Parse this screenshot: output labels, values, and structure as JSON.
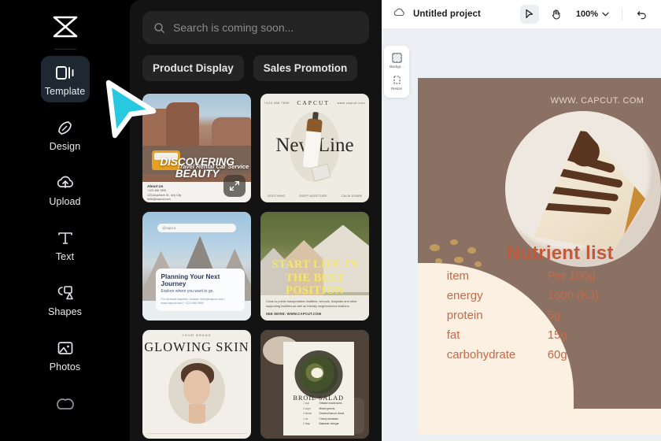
{
  "sidebar": {
    "logo_icon": "capcut-logo-icon",
    "items": [
      {
        "label": "Template",
        "icon": "template-icon",
        "active": true
      },
      {
        "label": "Design",
        "icon": "design-icon",
        "active": false
      },
      {
        "label": "Upload",
        "icon": "upload-cloud-icon",
        "active": false
      },
      {
        "label": "Text",
        "icon": "text-icon",
        "active": false
      },
      {
        "label": "Shapes",
        "icon": "shapes-icon",
        "active": false
      },
      {
        "label": "Photos",
        "icon": "photos-icon",
        "active": false
      }
    ]
  },
  "panel": {
    "search": {
      "placeholder": "Search is coming soon...",
      "icon": "search-icon"
    },
    "chips": [
      {
        "label": "Product Display"
      },
      {
        "label": "Sales Promotion"
      }
    ],
    "templates": [
      {
        "name": "travel-rental-car",
        "subtitle": "Travel Rental Car Service",
        "title": "DISCOVERING BEAUTY",
        "footer_heading": "About Us",
        "footer_lines": [
          "+123 456 7890",
          "123 Anywhere St., Any City",
          "hello@capcut.com"
        ],
        "expand_icon": "expand-icon"
      },
      {
        "name": "new-line-cosmetics",
        "brand": "CAPCUT",
        "top_left": "+123 456 7890",
        "top_right": "www.capcut.com",
        "title": "New Line",
        "footer": [
          "SOOTHING",
          "DEEP MOISTURE",
          "CALM DOWN"
        ]
      },
      {
        "name": "planning-next-journey",
        "url_bar": "@capcut",
        "title": "Planning Your Next Journey",
        "subtitle": "Explore where you want to go.",
        "footer": "For all travel inquiries, contact: hello@capcut.com | www.capcut.com | +123 456 7890"
      },
      {
        "name": "start-life-best-position",
        "title": "START LIFE IN THE BEST POSITION",
        "body": "Close to public transportation facilities, schools, hospitals and other supporting facilities,as well as friendly neighborhood relations.",
        "more": "SEE MORE: WWW.CAPCUT.COM"
      },
      {
        "name": "glowing-skin",
        "brand": "YOUR BRAND",
        "title": "GLOWING SKIN"
      },
      {
        "name": "broil-salad-recipe",
        "title": "BROIL SALAD",
        "rows": [
          {
            "amount": "1 cup",
            "item": "Shitake mushrooms"
          },
          {
            "amount": "2 cups",
            "item": "Mixed greens"
          },
          {
            "amount": "4 slices",
            "item": "Smoked bacon, diced"
          },
          {
            "amount": "1 oz",
            "item": "Cherry tomatoes"
          },
          {
            "amount": "2 tbsp",
            "item": "Balsamic vinegar"
          }
        ]
      }
    ]
  },
  "editor": {
    "cloud_icon": "cloud-icon",
    "project_title": "Untitled project",
    "tools": [
      {
        "label": "Backgr...",
        "icon": "background-checker-icon"
      },
      {
        "label": "Resize",
        "icon": "resize-icon"
      }
    ],
    "toolbar": {
      "select_tool_icon": "cursor-arrow-icon",
      "hand_tool_icon": "hand-icon",
      "zoom_value": "100%",
      "zoom_caret_icon": "chevron-down-icon",
      "undo_icon": "undo-icon"
    },
    "design": {
      "url": "WWW. CAPCUT. COM",
      "title": "Nutrient list",
      "rows": [
        {
          "key": "item",
          "value": "Per 100g"
        },
        {
          "key": "energy",
          "value": "1600 (KJ)"
        },
        {
          "key": "protein",
          "value": "5g"
        },
        {
          "key": "fat",
          "value": "15g"
        },
        {
          "key": "carbohydrate",
          "value": "60g"
        }
      ]
    }
  },
  "colors": {
    "accent_title": "#c05a3c",
    "accent_text": "#c46a4a",
    "canvas_bg": "#8b7164",
    "cream": "#fbf0e2",
    "cursor": "#28c8e0",
    "rail_active": "#1d2833"
  }
}
